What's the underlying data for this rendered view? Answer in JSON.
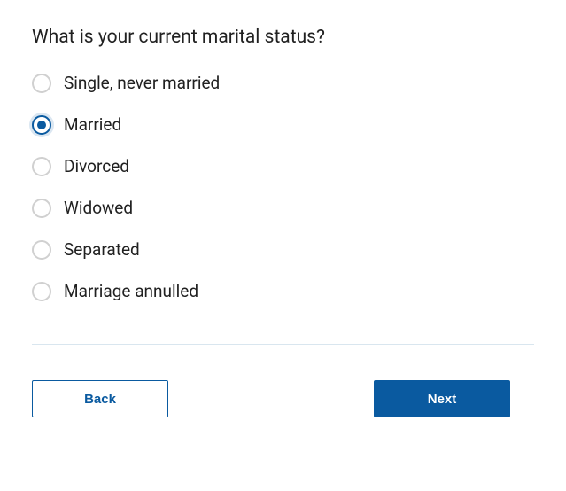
{
  "question": {
    "title": "What is your current marital status?",
    "options": [
      {
        "label": "Single, never married",
        "selected": false
      },
      {
        "label": "Married",
        "selected": true
      },
      {
        "label": "Divorced",
        "selected": false
      },
      {
        "label": "Widowed",
        "selected": false
      },
      {
        "label": "Separated",
        "selected": false
      },
      {
        "label": "Marriage annulled",
        "selected": false
      }
    ]
  },
  "buttons": {
    "back": "Back",
    "next": "Next"
  }
}
